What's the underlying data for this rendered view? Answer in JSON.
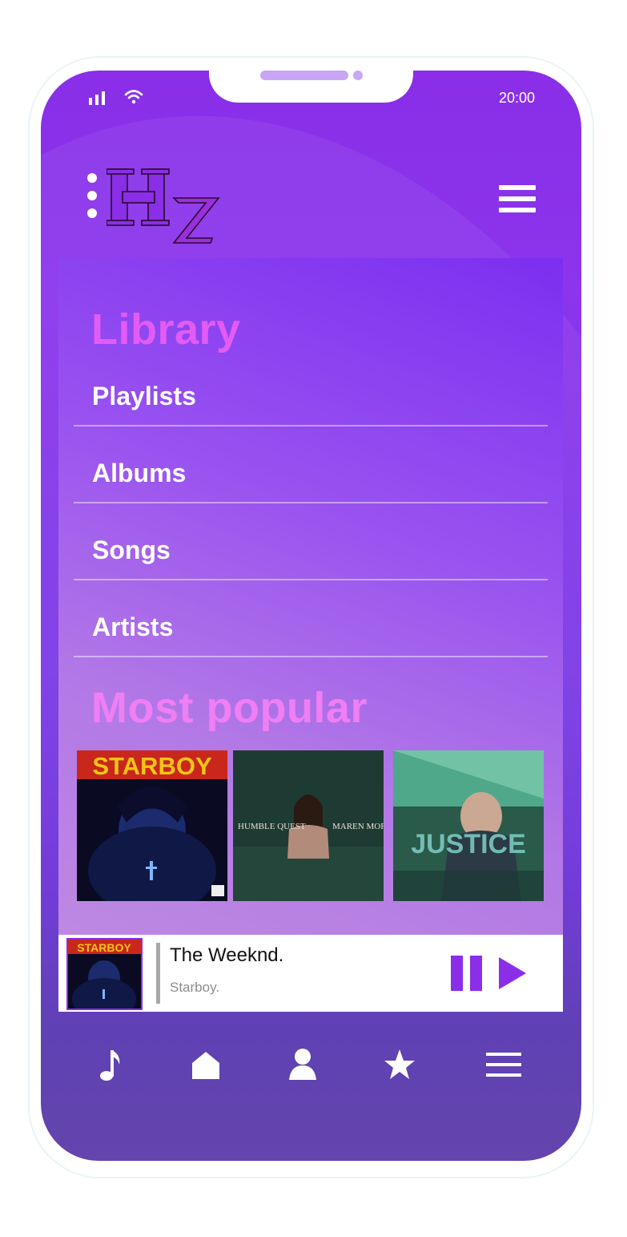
{
  "status_bar": {
    "time": "20:00",
    "signal_icon": "signal-icon",
    "wifi_icon": "wifi-icon"
  },
  "header": {
    "logo_text": "Hz",
    "menu_icon": "hamburger-menu-icon"
  },
  "library": {
    "title": "Library",
    "items": [
      {
        "label": "Playlists"
      },
      {
        "label": "Albums"
      },
      {
        "label": "Songs"
      },
      {
        "label": "Artists"
      }
    ]
  },
  "popular": {
    "title": "Most popular",
    "albums": [
      {
        "cover_text": "STARBOY"
      },
      {
        "cover_text_left": "HUMBLE QUEST",
        "cover_text_right": "MAREN MORRIS"
      },
      {
        "cover_text": "JUSTICE"
      }
    ]
  },
  "now_playing": {
    "artist": "The Weeknd.",
    "track": "Starboy.",
    "cover_text": "STARBOY"
  },
  "nav": [
    {
      "icon": "music-note-icon"
    },
    {
      "icon": "home-icon"
    },
    {
      "icon": "profile-icon"
    },
    {
      "icon": "star-icon"
    },
    {
      "icon": "menu-icon"
    }
  ],
  "colors": {
    "accent": "#8a2ee8",
    "title_pink": "#e35bf5"
  }
}
